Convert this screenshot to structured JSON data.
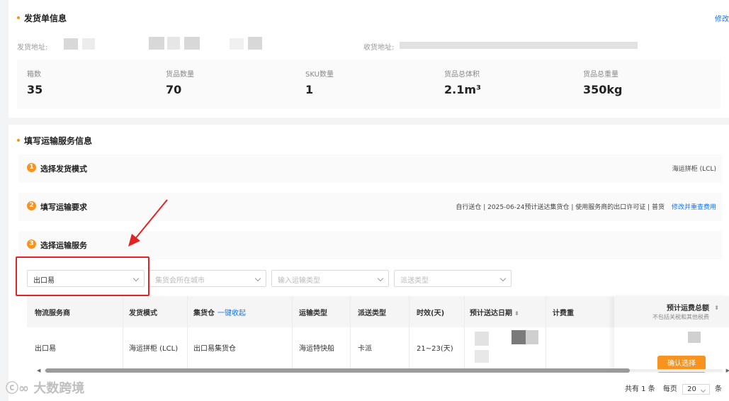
{
  "shipment": {
    "title": "发货单信息",
    "edit_label": "修改",
    "ship_from_label": "发货地址:",
    "ship_to_label": "收货地址:",
    "stats": [
      {
        "label": "箱数",
        "value": "35"
      },
      {
        "label": "货品数量",
        "value": "70"
      },
      {
        "label": "SKU数量",
        "value": "1"
      },
      {
        "label": "货品总体积",
        "value": "2.1m³"
      },
      {
        "label": "货品总重量",
        "value": "350kg"
      }
    ]
  },
  "transport": {
    "title": "填写运输服务信息",
    "steps": [
      {
        "num": "1",
        "title": "选择发货模式",
        "summary": "海运拼柜 (LCL)",
        "action": ""
      },
      {
        "num": "2",
        "title": "填写运输要求",
        "summary": "自行送仓 | 2025-06-24预计送达集货仓 | 使用服务商的出口许可证 | 普货",
        "action": "修改并重查费用"
      },
      {
        "num": "3",
        "title": "选择运输服务",
        "summary": "",
        "action": ""
      }
    ],
    "filters": {
      "carrier": "出口易",
      "city_placeholder": "集货会所在城市",
      "transport_type_placeholder": "输入运输类型",
      "delivery_type_placeholder": "派送类型"
    },
    "table": {
      "headers": {
        "carrier": "物流服务商",
        "mode": "发货模式",
        "warehouse": "集货仓",
        "collapse": "一键收起",
        "transport_type": "运输类型",
        "delivery_type": "派送类型",
        "duration": "时效(天)",
        "eta": "预计送达日期",
        "billing_weight": "计费重",
        "total_fee": "预计运费总额",
        "total_fee_note": "不包括关税和其他税费"
      },
      "rows": [
        {
          "carrier": "出口易",
          "mode": "海运拼柜 (LCL)",
          "warehouse": "出口易集货仓",
          "transport_type": "海运特快船",
          "delivery_type": "卡派",
          "duration": "21~23(天)"
        }
      ],
      "confirm_label": "确认选择"
    },
    "pagination": {
      "total_text": "共有 1 条",
      "per_page_label": "每页",
      "per_page_value": "20",
      "unit": "条"
    }
  },
  "watermark": "大数跨境",
  "colors": {
    "accent": "#f7931e",
    "link": "#1a73e8",
    "highlight_border": "#e02424"
  }
}
